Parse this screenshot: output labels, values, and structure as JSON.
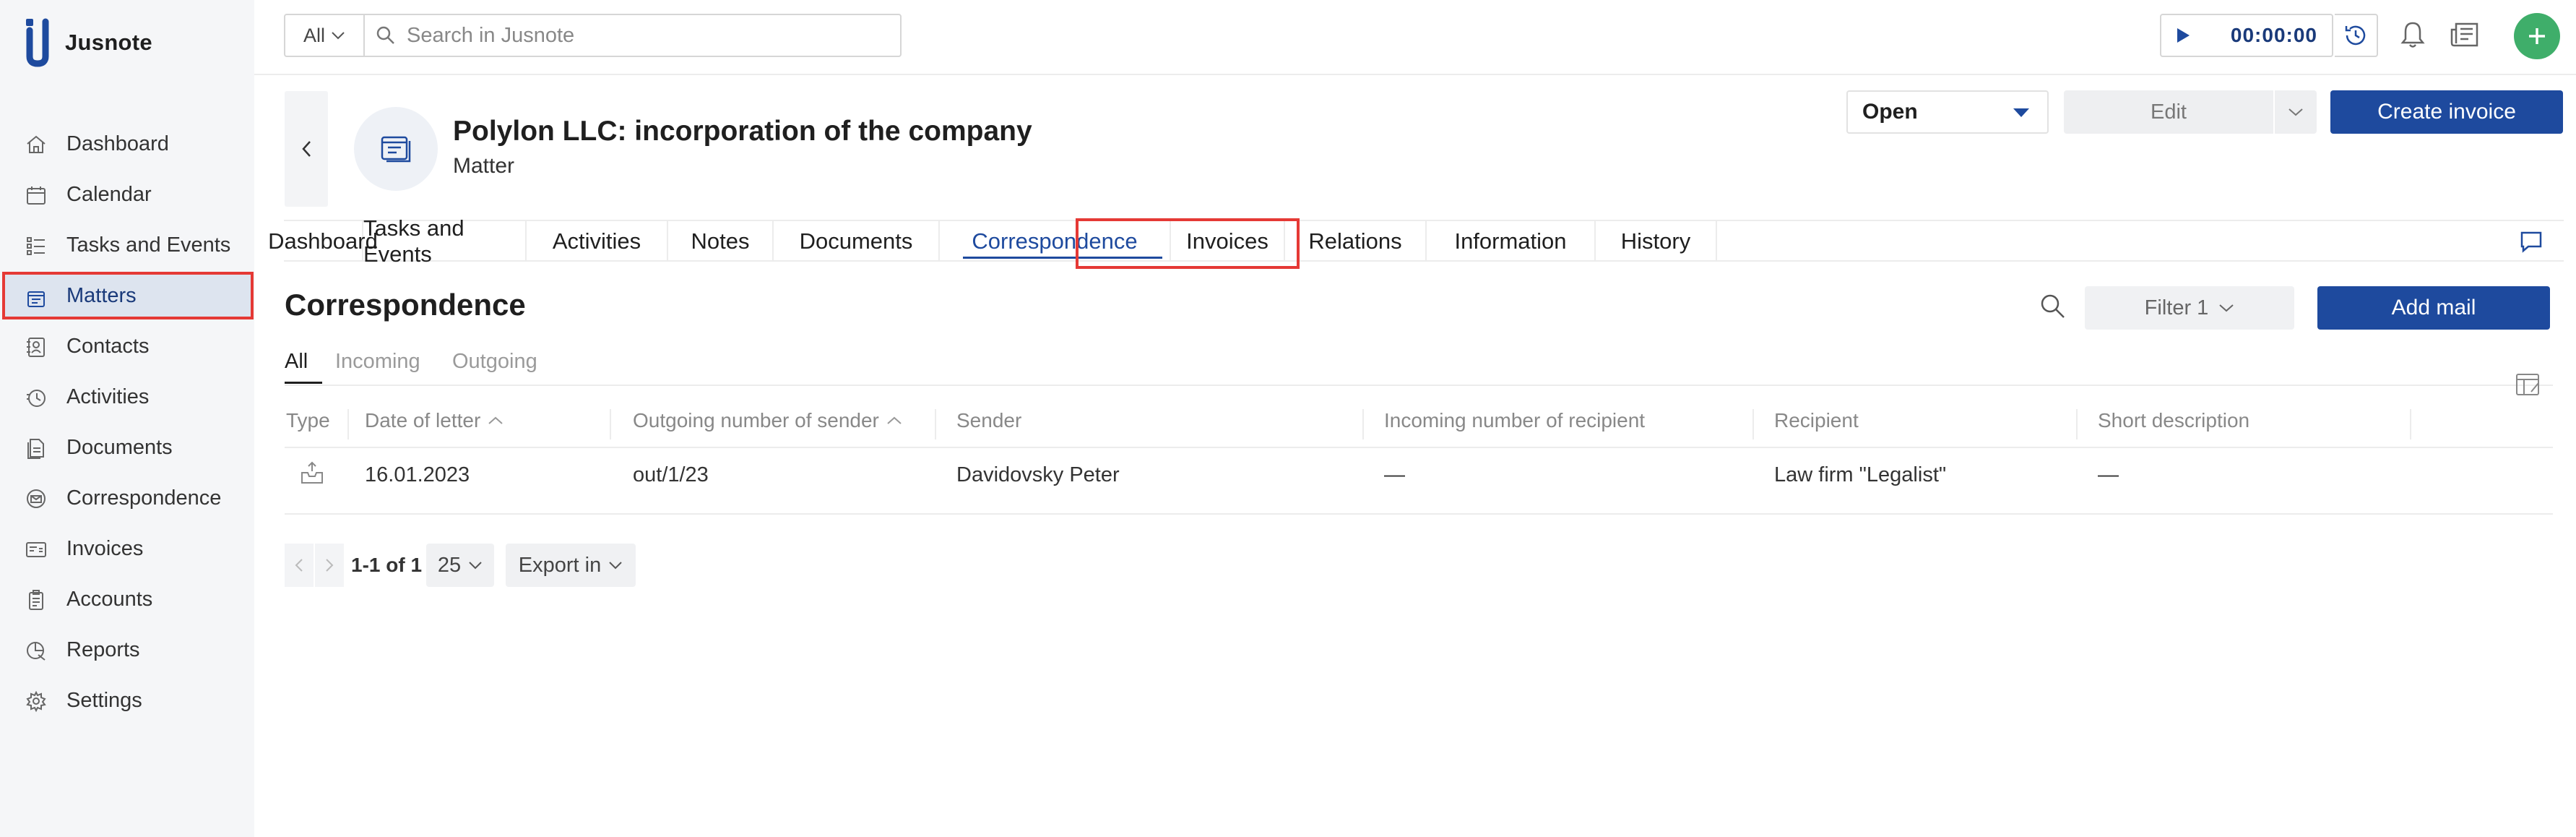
{
  "app": {
    "name": "Jusnote"
  },
  "sidebar": {
    "items": [
      {
        "label": "Dashboard",
        "icon": "home-icon"
      },
      {
        "label": "Calendar",
        "icon": "calendar-icon"
      },
      {
        "label": "Tasks and Events",
        "icon": "tasks-icon"
      },
      {
        "label": "Matters",
        "icon": "matters-icon",
        "active": true
      },
      {
        "label": "Contacts",
        "icon": "contacts-icon"
      },
      {
        "label": "Activities",
        "icon": "activities-icon"
      },
      {
        "label": "Documents",
        "icon": "documents-icon"
      },
      {
        "label": "Correspondence",
        "icon": "correspondence-icon"
      },
      {
        "label": "Invoices",
        "icon": "invoices-icon"
      },
      {
        "label": "Accounts",
        "icon": "accounts-icon"
      },
      {
        "label": "Reports",
        "icon": "reports-icon"
      },
      {
        "label": "Settings",
        "icon": "settings-icon"
      }
    ]
  },
  "topbar": {
    "scope": "All",
    "search_placeholder": "Search in Jusnote",
    "timer": "00:00:00"
  },
  "matter": {
    "title": "Polylon LLC: incorporation of the company",
    "subtitle": "Matter",
    "status": "Open",
    "edit_label": "Edit",
    "create_invoice_label": "Create invoice"
  },
  "tabs": [
    {
      "label": "Dashboard"
    },
    {
      "label": "Tasks and Events"
    },
    {
      "label": "Activities"
    },
    {
      "label": "Notes"
    },
    {
      "label": "Documents"
    },
    {
      "label": "Correspondence",
      "active": true
    },
    {
      "label": "Invoices"
    },
    {
      "label": "Relations"
    },
    {
      "label": "Information"
    },
    {
      "label": "History"
    }
  ],
  "section": {
    "title": "Correspondence",
    "filter_label": "Filter 1",
    "add_mail_label": "Add mail",
    "subtabs": [
      "All",
      "Incoming",
      "Outgoing"
    ]
  },
  "table": {
    "headers": [
      "Type",
      "Date of letter",
      "Outgoing number of sender",
      "Sender",
      "Incoming number of recipient",
      "Recipient",
      "Short description"
    ],
    "rows": [
      {
        "type_icon": "outgoing-mail-icon",
        "date": "16.01.2023",
        "outgoing_number": "out/1/23",
        "sender": "Davidovsky Peter",
        "incoming_number": "—",
        "recipient": "Law firm \"Legalist\"",
        "description": "—"
      }
    ]
  },
  "pagination": {
    "range": "1-1 of 1",
    "page_size": "25",
    "export_label": "Export in"
  },
  "colors": {
    "primary": "#1e4a9e",
    "highlight": "#e53935",
    "add_button": "#3fae6a",
    "sidebar_bg": "#f5f6f8"
  }
}
